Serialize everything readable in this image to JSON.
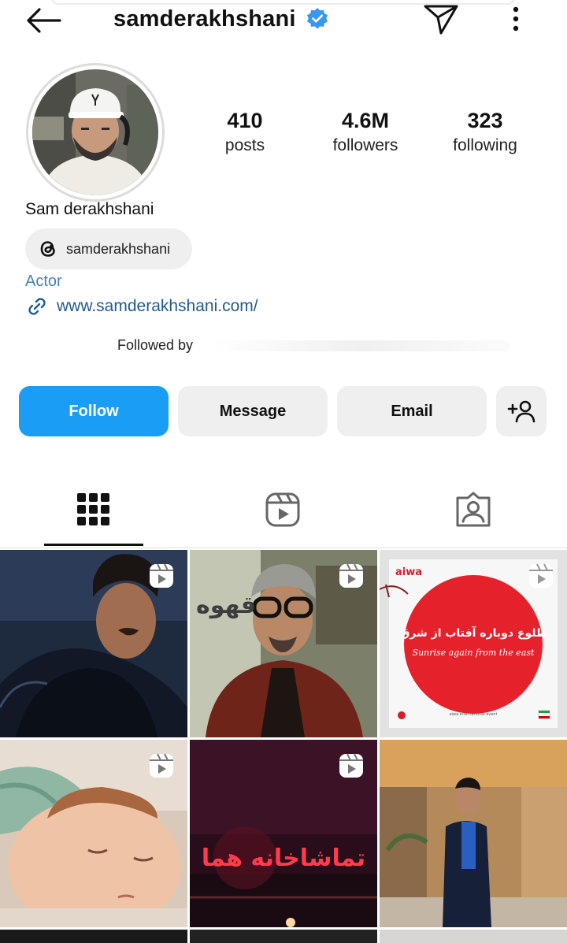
{
  "header": {
    "username": "samderakhshani",
    "back_icon": "arrow-left-icon",
    "verified_icon": "verified-badge-icon",
    "verified_color": "#3897f0",
    "send_icon": "send-icon",
    "more_icon": "more-vertical-icon"
  },
  "profile": {
    "name": "Sam derakhshani",
    "stats": [
      {
        "value": "410",
        "label": "posts"
      },
      {
        "value": "4.6M",
        "label": "followers"
      },
      {
        "value": "323",
        "label": "following"
      }
    ],
    "threads_handle": "samderakhshani",
    "category": "Actor",
    "website": "www.samderakhshani.com/",
    "followed_by": "Followed by"
  },
  "actions": {
    "follow": "Follow",
    "message": "Message",
    "email": "Email",
    "add_user_icon": "add-user-icon",
    "follow_color": "#1a9ef5"
  },
  "tabs": [
    {
      "icon": "grid-icon",
      "active": true
    },
    {
      "icon": "reels-icon",
      "active": false
    },
    {
      "icon": "tagged-icon",
      "active": false
    }
  ],
  "grid": {
    "post3_brand": "aiwa",
    "post3_headline": "طلوع دوباره آفتاب از شرق",
    "post3_subtitle": "Sunrise again from the east",
    "post3_footer": "aiwa international event",
    "post5_text": "تماشاخانه هما",
    "post2_text": "قهوه"
  }
}
